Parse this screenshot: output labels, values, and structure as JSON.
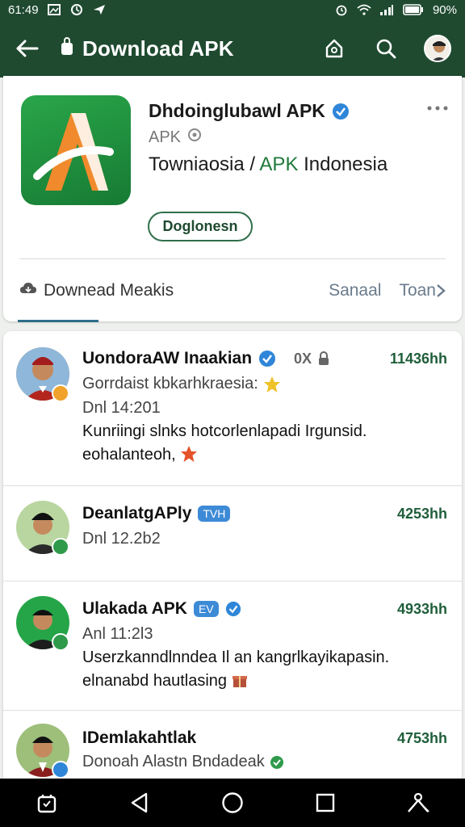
{
  "status_bar": {
    "time": "61:49",
    "battery": "90%",
    "left_icons": [
      "gallery-icon",
      "sync-icon",
      "send-icon"
    ],
    "right_icons": [
      "alarm-icon",
      "wifi-icon",
      "signal-icon",
      "battery-icon"
    ]
  },
  "app_bar": {
    "title": "Download APK",
    "back_icon": "back-arrow-icon",
    "title_icon": "bag-icon",
    "actions": [
      "bell-home-icon",
      "search-icon",
      "profile-avatar"
    ],
    "color": "#1f4a30"
  },
  "app_card": {
    "name": "Dhdoinglubawl APK",
    "type": "APK",
    "desc_prefix": "Towniaosia /",
    "desc_accent": "APK",
    "desc_suffix": "Indonesia",
    "button_label": "Doglonesn",
    "tab_main": "Downead Meakis",
    "tab_right_1": "Sanaal",
    "tab_right_2": "Toan",
    "accent_color": "#1f7a3a"
  },
  "posts": [
    {
      "name": "UondoraAW Inaakian",
      "extra": "0X",
      "time": "11436hh",
      "subtitle": "Gorrdaist kbkarhkraesia:",
      "date": "Dnl 14:201",
      "body": "Kunriingi slnks hotcorlenlapadi Irgunsid. eohalanteoh,"
    },
    {
      "name": "DeanlatgAPly",
      "tag": "TVH",
      "time": "4253hh",
      "date": "Dnl 12.2b2"
    },
    {
      "name": "Ulakada APK",
      "tag": "EV",
      "time": "4933hh",
      "date": "Anl 11:2l3",
      "body": "Userzkanndlnndea Il an kangrlkayikapasin. elnanabd hautlasing"
    },
    {
      "name": "IDemlakahtlak",
      "time": "4753hh",
      "subtitle": "Donoah Alastn Bndadeak"
    }
  ],
  "nav_bar": {
    "buttons": [
      "app-switcher-icon",
      "back-triangle-icon",
      "home-circle-icon",
      "recents-square-icon",
      "assist-icon"
    ]
  }
}
